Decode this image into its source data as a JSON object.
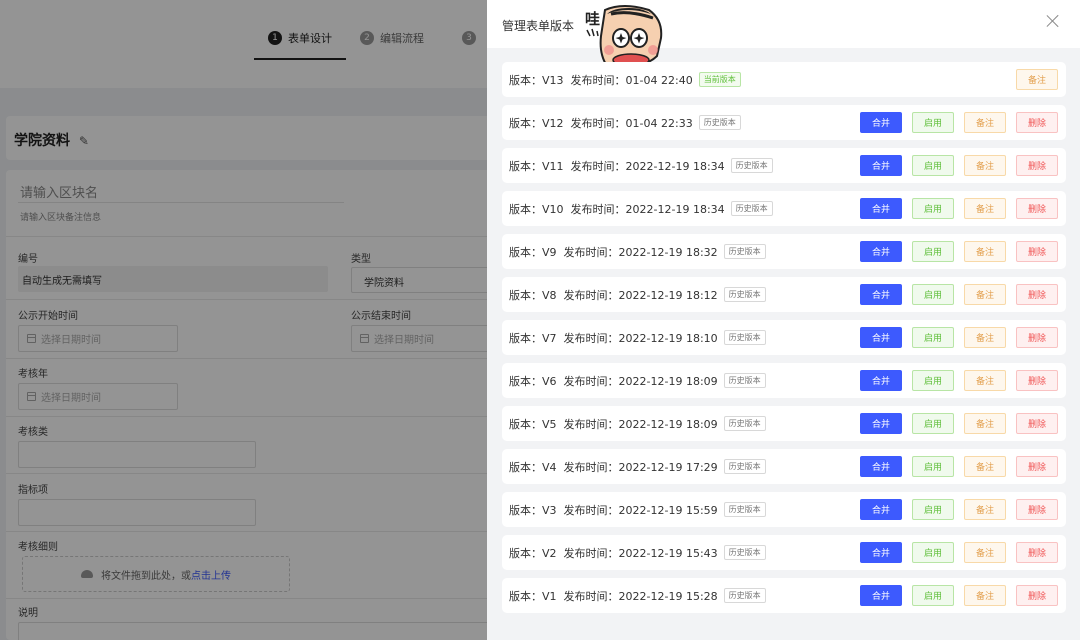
{
  "steps": [
    {
      "num": "1",
      "label": "表单设计"
    },
    {
      "num": "2",
      "label": "编辑流程"
    },
    {
      "num": "3",
      "label": ""
    }
  ],
  "form": {
    "title": "学院资料",
    "block_name_placeholder": "请输入区块名",
    "block_desc_placeholder": "请输入区块备注信息",
    "fields": {
      "number_label": "编号",
      "number_value": "自动生成无需填写",
      "type_label": "类型",
      "type_value": "学院资料",
      "public_start_label": "公示开始时间",
      "public_end_label": "公示结束时间",
      "date_placeholder": "选择日期时间",
      "year_label": "考核年",
      "category_label": "考核类",
      "indicator_label": "指标项",
      "detail_label": "考核细则",
      "upload_text": "将文件拖到此处，或",
      "upload_link": "点击上传",
      "desc_label": "说明"
    }
  },
  "drawer": {
    "title": "管理表单版本",
    "sticker_text": "哇",
    "buttons": {
      "merge": "合并",
      "enable": "启用",
      "note": "备注",
      "delete": "删除"
    },
    "versions": [
      {
        "ver": "版本：V13",
        "time": "发布时间：01-04 22:40",
        "tag": "当前版本",
        "current": true
      },
      {
        "ver": "版本：V12",
        "time": "发布时间：01-04 22:33",
        "tag": "历史版本",
        "current": false
      },
      {
        "ver": "版本：V11",
        "time": "发布时间：2022-12-19 18:34",
        "tag": "历史版本",
        "current": false
      },
      {
        "ver": "版本：V10",
        "time": "发布时间：2022-12-19 18:34",
        "tag": "历史版本",
        "current": false
      },
      {
        "ver": "版本：V9",
        "time": "发布时间：2022-12-19 18:32",
        "tag": "历史版本",
        "current": false
      },
      {
        "ver": "版本：V8",
        "time": "发布时间：2022-12-19 18:12",
        "tag": "历史版本",
        "current": false
      },
      {
        "ver": "版本：V7",
        "time": "发布时间：2022-12-19 18:10",
        "tag": "历史版本",
        "current": false
      },
      {
        "ver": "版本：V6",
        "time": "发布时间：2022-12-19 18:09",
        "tag": "历史版本",
        "current": false
      },
      {
        "ver": "版本：V5",
        "time": "发布时间：2022-12-19 18:09",
        "tag": "历史版本",
        "current": false
      },
      {
        "ver": "版本：V4",
        "time": "发布时间：2022-12-19 17:29",
        "tag": "历史版本",
        "current": false
      },
      {
        "ver": "版本：V3",
        "time": "发布时间：2022-12-19 15:59",
        "tag": "历史版本",
        "current": false
      },
      {
        "ver": "版本：V2",
        "time": "发布时间：2022-12-19 15:43",
        "tag": "历史版本",
        "current": false
      },
      {
        "ver": "版本：V1",
        "time": "发布时间：2022-12-19 15:28",
        "tag": "历史版本",
        "current": false
      }
    ]
  },
  "colors": {
    "primary": "#3d5afe",
    "success": "#5fbf3a",
    "warning": "#e3a04f",
    "danger": "#f05656"
  },
  "icons": [
    "edit-icon",
    "calendar-icon",
    "cloud-upload-icon",
    "close-icon"
  ]
}
